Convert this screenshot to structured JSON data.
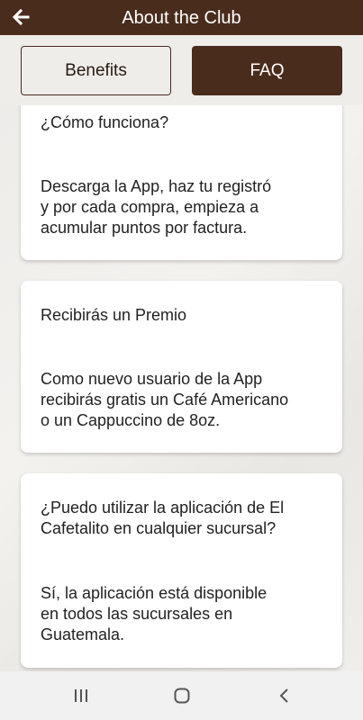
{
  "header": {
    "title": "About the Club",
    "back_icon": "arrow-left-icon"
  },
  "tabs": [
    {
      "label": "Benefits",
      "selected": false
    },
    {
      "label": "FAQ",
      "selected": true
    }
  ],
  "faq": [
    {
      "question": "¿Cómo funciona?",
      "answer": "Descarga la App, haz tu registró\ny por cada compra, empieza  a\nacumular puntos por factura."
    },
    {
      "question": "Recibirás un Premio",
      "answer": "Como nuevo usuario de la App\nrecibirás gratis un Café Americano\no un Cappuccino de 8oz."
    },
    {
      "question": "¿Puedo utilizar la aplicación de El Cafetalito en cualquier sucursal?",
      "answer": "Sí, la aplicación está disponible\nen todos las sucursales en\nGuatemala."
    }
  ],
  "navbar": {
    "recents_icon": "recents-icon",
    "home_icon": "home-icon",
    "back_icon": "back-chevron-icon"
  },
  "colors": {
    "brand": "#4a2c1d",
    "background": "#efedea",
    "card": "#ffffff"
  }
}
